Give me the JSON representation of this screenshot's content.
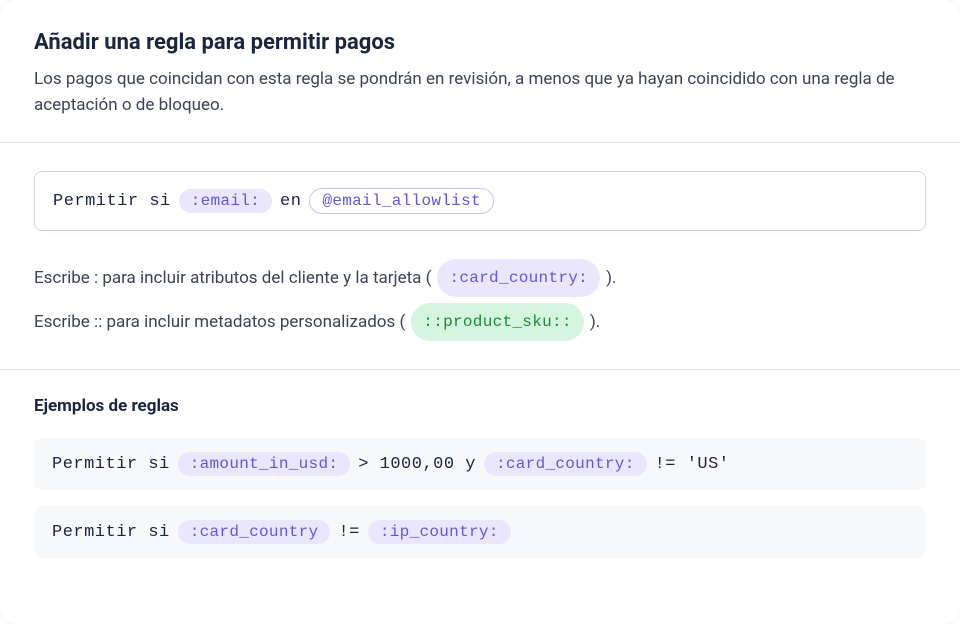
{
  "header": {
    "title": "Añadir una regla para permitir pagos",
    "subtitle": "Los pagos que coincidan con esta regla se pondrán en revisión, a menos que ya hayan coincidido con una regla de aceptación o de bloqueo."
  },
  "rule_input": {
    "prefix": "Permitir si",
    "email_token": ":email:",
    "operator": "en",
    "list_token": "@email_allowlist"
  },
  "hints": {
    "line1_prefix": "Escribe : para incluir atributos del cliente y la tarjeta (",
    "line1_token": ":card_country:",
    "line1_suffix": ").",
    "line2_prefix": "Escribe :: para incluir metadatos personalizados (",
    "line2_token": "::product_sku::",
    "line2_suffix": ")."
  },
  "examples": {
    "title": "Ejemplos de reglas",
    "rule1": {
      "prefix": "Permitir si",
      "token1": ":amount_in_usd:",
      "op1": "> 1000,00 y",
      "token2": ":card_country:",
      "op2": "!= 'US'"
    },
    "rule2": {
      "prefix": "Permitir si",
      "token1": ":card_country",
      "op1": "!=",
      "token2": ":ip_country:"
    }
  }
}
